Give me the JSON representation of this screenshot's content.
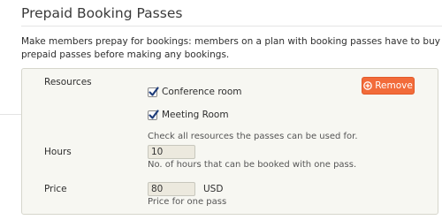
{
  "page": {
    "title": "Prepaid Booking Passes",
    "description": "Make members prepay for bookings: members on a plan with booking passes have to buy prepaid passes before making any bookings."
  },
  "pass": {
    "remove_label": "Remove",
    "resources": {
      "label": "Resources",
      "options": [
        {
          "label": "Conference room",
          "checked": true
        },
        {
          "label": "Meeting Room",
          "checked": true
        }
      ],
      "help": "Check all resources the passes can be used for."
    },
    "hours": {
      "label": "Hours",
      "value": "10",
      "help": "No. of hours that can be booked with one pass."
    },
    "price": {
      "label": "Price",
      "value": "80",
      "currency": "USD",
      "help": "Price for one pass"
    }
  },
  "colors": {
    "accent": "#f26b3a",
    "panel_background": "#f7f7f2",
    "input_background": "#ece9de"
  },
  "icons": {
    "remove": "circled-plus-icon",
    "checkbox": "checkmark-icon"
  }
}
